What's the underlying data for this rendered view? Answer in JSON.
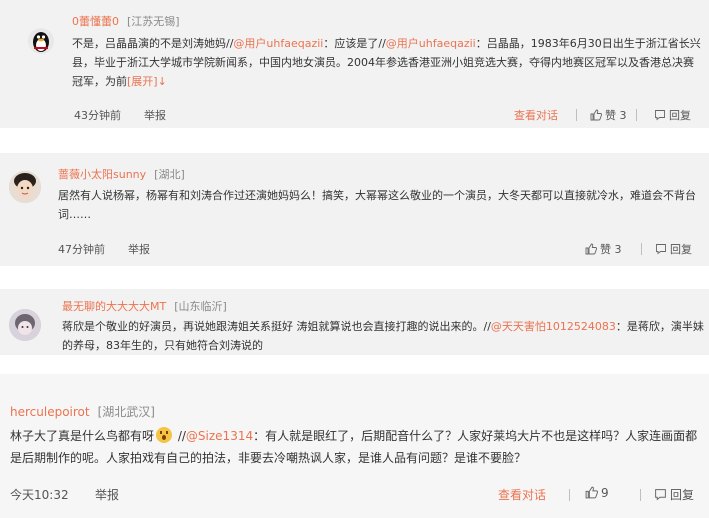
{
  "comments": [
    {
      "username": "0蕾懂蕾0",
      "location": "[江苏无锡]",
      "text_lead": "不是，吕晶晶演的不是刘涛她妈//",
      "mention1": "@用户uhfaeqazii",
      "text_mid": "：应该是了//",
      "mention2": "@用户uhfaeqazii",
      "text_rest": "：吕晶晶，1983年6月30日出生于浙江省长兴县，毕业于浙江大学城市学院新闻系，中国内地女演员。2004年参选香港亚洲小姐竞选大赛，夺得内地赛区冠军以及香港总决赛冠军，为前",
      "expand": "[展开]↓",
      "time": "43分钟前",
      "report": "举报",
      "view_convo": "查看对话",
      "likes": "赞 3",
      "reply": "回复"
    },
    {
      "username": "蔷薇小太阳sunny",
      "location": "[湖北]",
      "text": "居然有人说杨幂，杨幂有和刘涛合作过还演她妈妈么！搞笑，大幂幂这么敬业的一个演员，大冬天都可以直接就冷水，难道会不背台词……",
      "time": "47分钟前",
      "report": "举报",
      "likes": "赞 3",
      "reply": "回复"
    },
    {
      "username": "最无聊的大大大大MT",
      "location": "[山东临沂]",
      "text_lead": "蒋欣是个敬业的好演员，再说她跟涛姐关系挺好 涛姐就算说也会直接打趣的说出来的。//",
      "mention": "@天天害怕1012524083",
      "text_rest": "：是蒋欣，演半妹的养母，83年生的，只有她符合刘涛说的"
    },
    {
      "username": "herculepoirot",
      "location": "[湖北武汉]",
      "text_lead": "林子大了真是什么鸟都有呀",
      "sep": " //",
      "mention": "@Size1314",
      "text_rest": "：有人就是眼红了，后期配音什么了？人家好莱坞大片不也是这样吗？人家连画面都是后期制作的呢。人家拍戏有自己的拍法，非要去冷嘲热讽人家，是谁人品有问题？是谁不要脸？",
      "time": "今天10:32",
      "report": "举报",
      "view_convo": "查看对话",
      "likes": "9",
      "reply": "回复"
    }
  ],
  "colors": {
    "accent": "#eb7350",
    "background": "#f2f2f2"
  }
}
